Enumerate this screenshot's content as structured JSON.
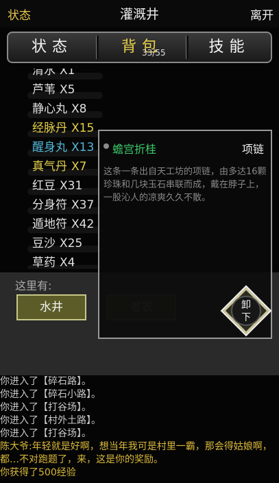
{
  "topbar": {
    "status_link": "状态",
    "title": "灌溉井",
    "leave": "离开"
  },
  "tabs": [
    {
      "label": "状态"
    },
    {
      "label": "背包"
    },
    {
      "label": "技能"
    }
  ],
  "bag_count": "33/55",
  "items": [
    {
      "name": "清水",
      "qty": "X1",
      "color": "#e0e0e0"
    },
    {
      "name": "芦苇",
      "qty": "X5",
      "color": "#e0e0e0"
    },
    {
      "name": "静心丸",
      "qty": "X8",
      "color": "#e0e0e0"
    },
    {
      "name": "经脉丹",
      "qty": "X15",
      "color": "#e6d04a"
    },
    {
      "name": "醒身丸",
      "qty": "X13",
      "color": "#53b8d8"
    },
    {
      "name": "真气丹",
      "qty": "X7",
      "color": "#e6d04a"
    },
    {
      "name": "红豆",
      "qty": "X31",
      "color": "#e0e0e0"
    },
    {
      "name": "分身符",
      "qty": "X37",
      "color": "#e0e0e0"
    },
    {
      "name": "遁地符",
      "qty": "X42",
      "color": "#e0e0e0"
    },
    {
      "name": "豆沙",
      "qty": "X25",
      "color": "#e0e0e0"
    },
    {
      "name": "草药",
      "qty": "X4",
      "color": "#e0e0e0"
    }
  ],
  "here": {
    "label": "这里有:",
    "buttons": [
      "水井",
      "老农"
    ]
  },
  "popup": {
    "name": "蟾宫折桂",
    "type": "项链",
    "desc": "这条一条出自天工坊的项链，由多达16颗珍珠和几块玉石串联而成，戴在脖子上，一股沁人的凉爽久久不散。",
    "unequip": [
      "卸",
      "下"
    ]
  },
  "log": [
    "你进入了【碎石路】。",
    "你进入了【碎石小路】。",
    "你进入了【打谷场】。",
    "你进入了【村外土路】。",
    "你进入了【打谷场】。",
    "陈大爷:年轻就是好啊，想当年我可是村里一霸，那会得姑娘啊，都…不对跑题了，来，这是你的奖励。",
    "你获得了500经验"
  ]
}
